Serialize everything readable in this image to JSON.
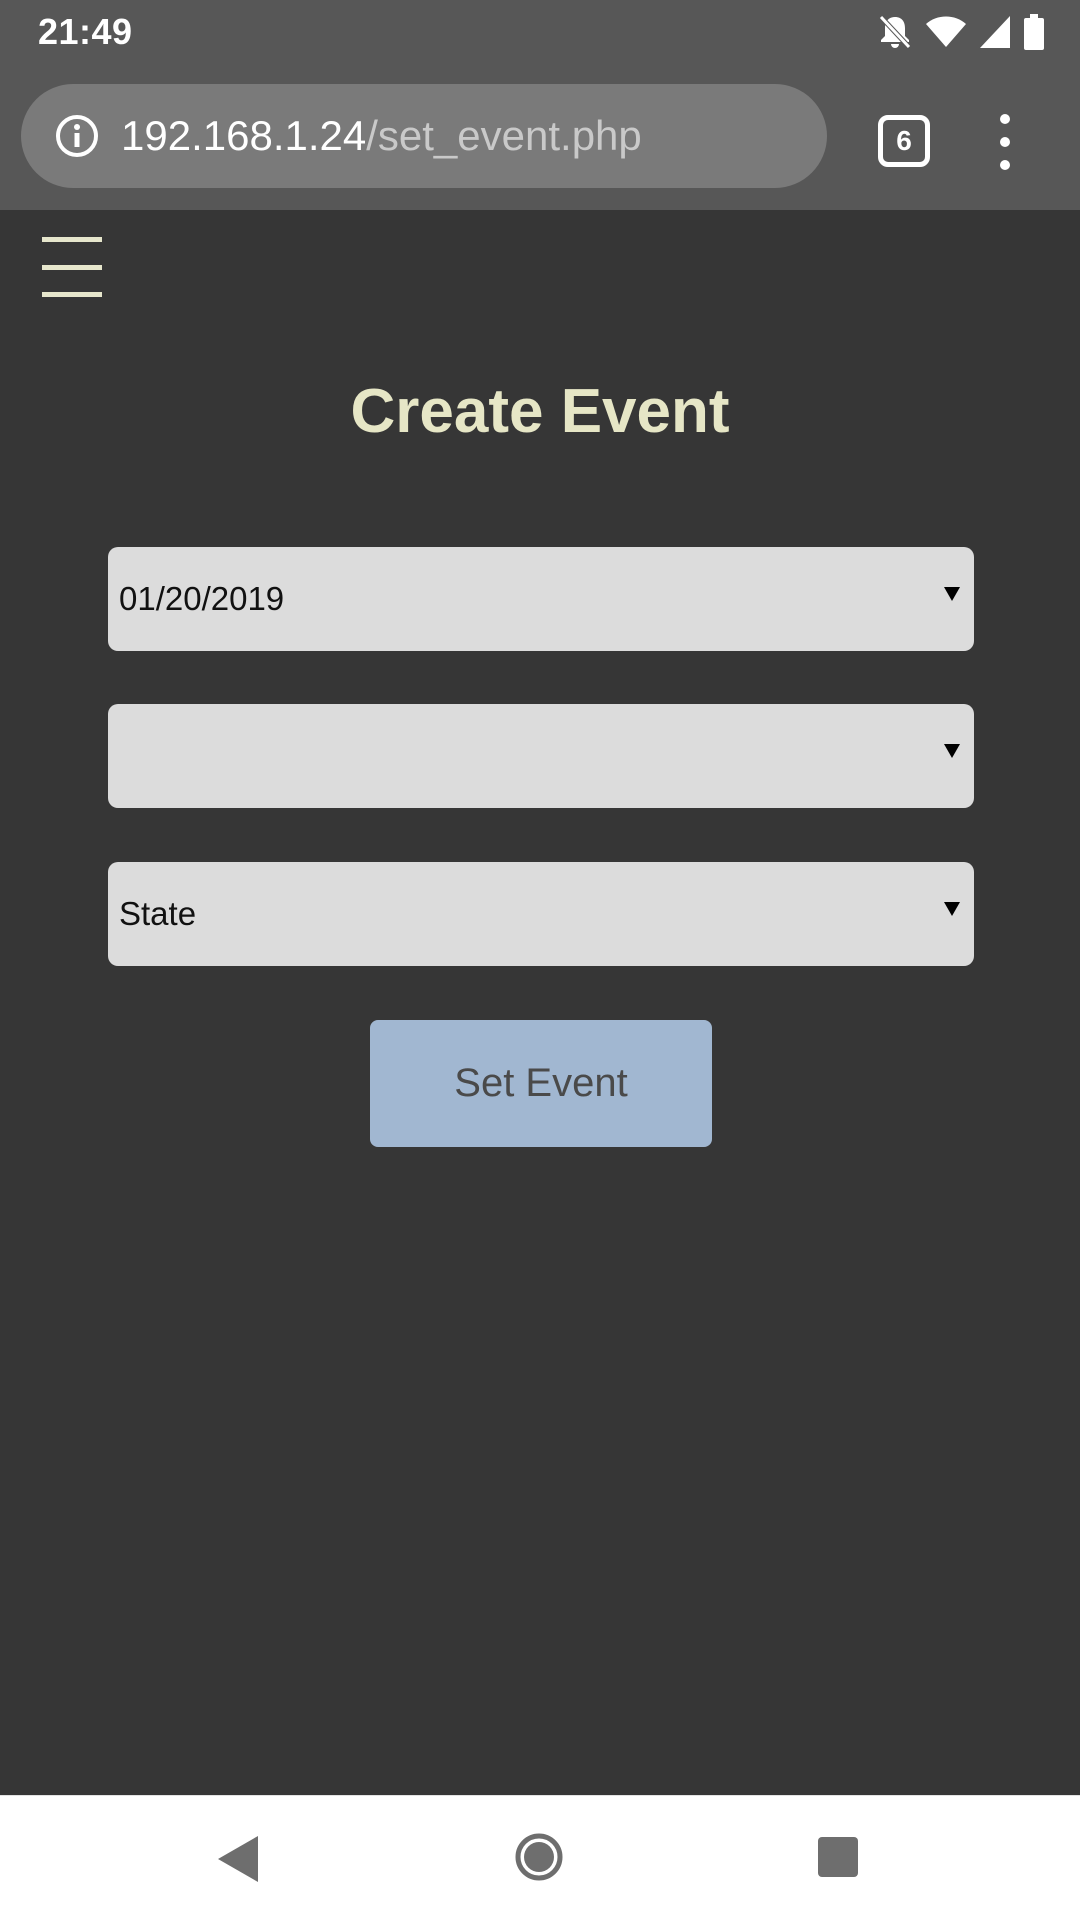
{
  "status_bar": {
    "time": "21:49",
    "icons": [
      "notifications-off-icon",
      "wifi-icon",
      "cell-signal-icon",
      "battery-icon"
    ]
  },
  "browser": {
    "url_host": "192.168.1.24",
    "url_path": "/set_event.php",
    "tab_count": "6",
    "icons": [
      "info-icon",
      "tab-switcher-icon",
      "more-vert-icon"
    ]
  },
  "page": {
    "menu_icon": "hamburger-menu-icon",
    "title": "Create Event",
    "selects": [
      {
        "value": "01/20/2019"
      },
      {
        "value": ""
      },
      {
        "value": "State"
      }
    ],
    "submit_label": "Set Event"
  },
  "nav_bar": {
    "icons": [
      "back-icon",
      "home-icon",
      "recents-icon"
    ]
  },
  "colors": {
    "chrome_bar": "#575757",
    "url_pill": "#7a7a7a",
    "page_background": "#363636",
    "title_text": "#e6e6c6",
    "select_background": "#dcdcdc",
    "button_background": "#a1b7d1",
    "button_text": "#4a4a4a",
    "nav_bar_background": "#ffffff"
  }
}
